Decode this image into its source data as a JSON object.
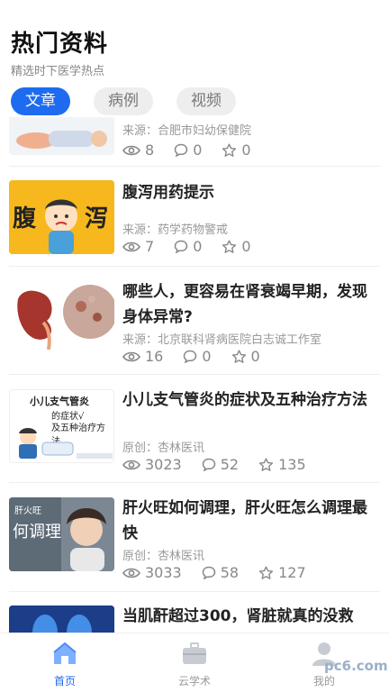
{
  "header": {
    "title": "热门资料",
    "subtitle": "精选时下医学热点"
  },
  "tabs": [
    {
      "label": "文章",
      "active": true
    },
    {
      "label": "病例",
      "active": false
    },
    {
      "label": "视频",
      "active": false
    }
  ],
  "feed": [
    {
      "title": "",
      "source": "来源：合肥市妇幼保健院",
      "views": "8",
      "comments": "0",
      "likes": "0"
    },
    {
      "title": "腹泻用药提示",
      "source": "来源：药学药物警戒",
      "views": "7",
      "comments": "0",
      "likes": "0",
      "thumb_text_left": "腹",
      "thumb_text_right": "泻"
    },
    {
      "title": "哪些人，更容易在肾衰竭早期，发现身体异常?",
      "source": "来源：北京联科肾病医院白志诚工作室",
      "views": "16",
      "comments": "0",
      "likes": "0"
    },
    {
      "title": "小儿支气管炎的症状及五种治疗方法",
      "source": "原创：杏林医讯",
      "views": "3023",
      "comments": "52",
      "likes": "135",
      "thumb_caption_1": "小儿支气管炎",
      "thumb_caption_2": "的症状√",
      "thumb_caption_3": "及五种治疗方法"
    },
    {
      "title": "肝火旺如何调理，肝火旺怎么调理最快",
      "source": "原创：杏林医讯",
      "views": "3033",
      "comments": "58",
      "likes": "127",
      "thumb_caption_1": "肝火旺",
      "thumb_caption_2": "何调理"
    },
    {
      "title": "当肌酐超过300，肾脏就真的没救",
      "source": "",
      "views": "",
      "comments": "",
      "likes": ""
    }
  ],
  "nav": [
    {
      "label": "首页",
      "icon": "home-icon",
      "active": true
    },
    {
      "label": "云学术",
      "icon": "briefcase-icon",
      "active": false
    },
    {
      "label": "我的",
      "icon": "user-icon",
      "active": false
    }
  ],
  "watermark": "pc6.com",
  "colors": {
    "accent": "#1e6bf0",
    "muted": "#888888"
  }
}
